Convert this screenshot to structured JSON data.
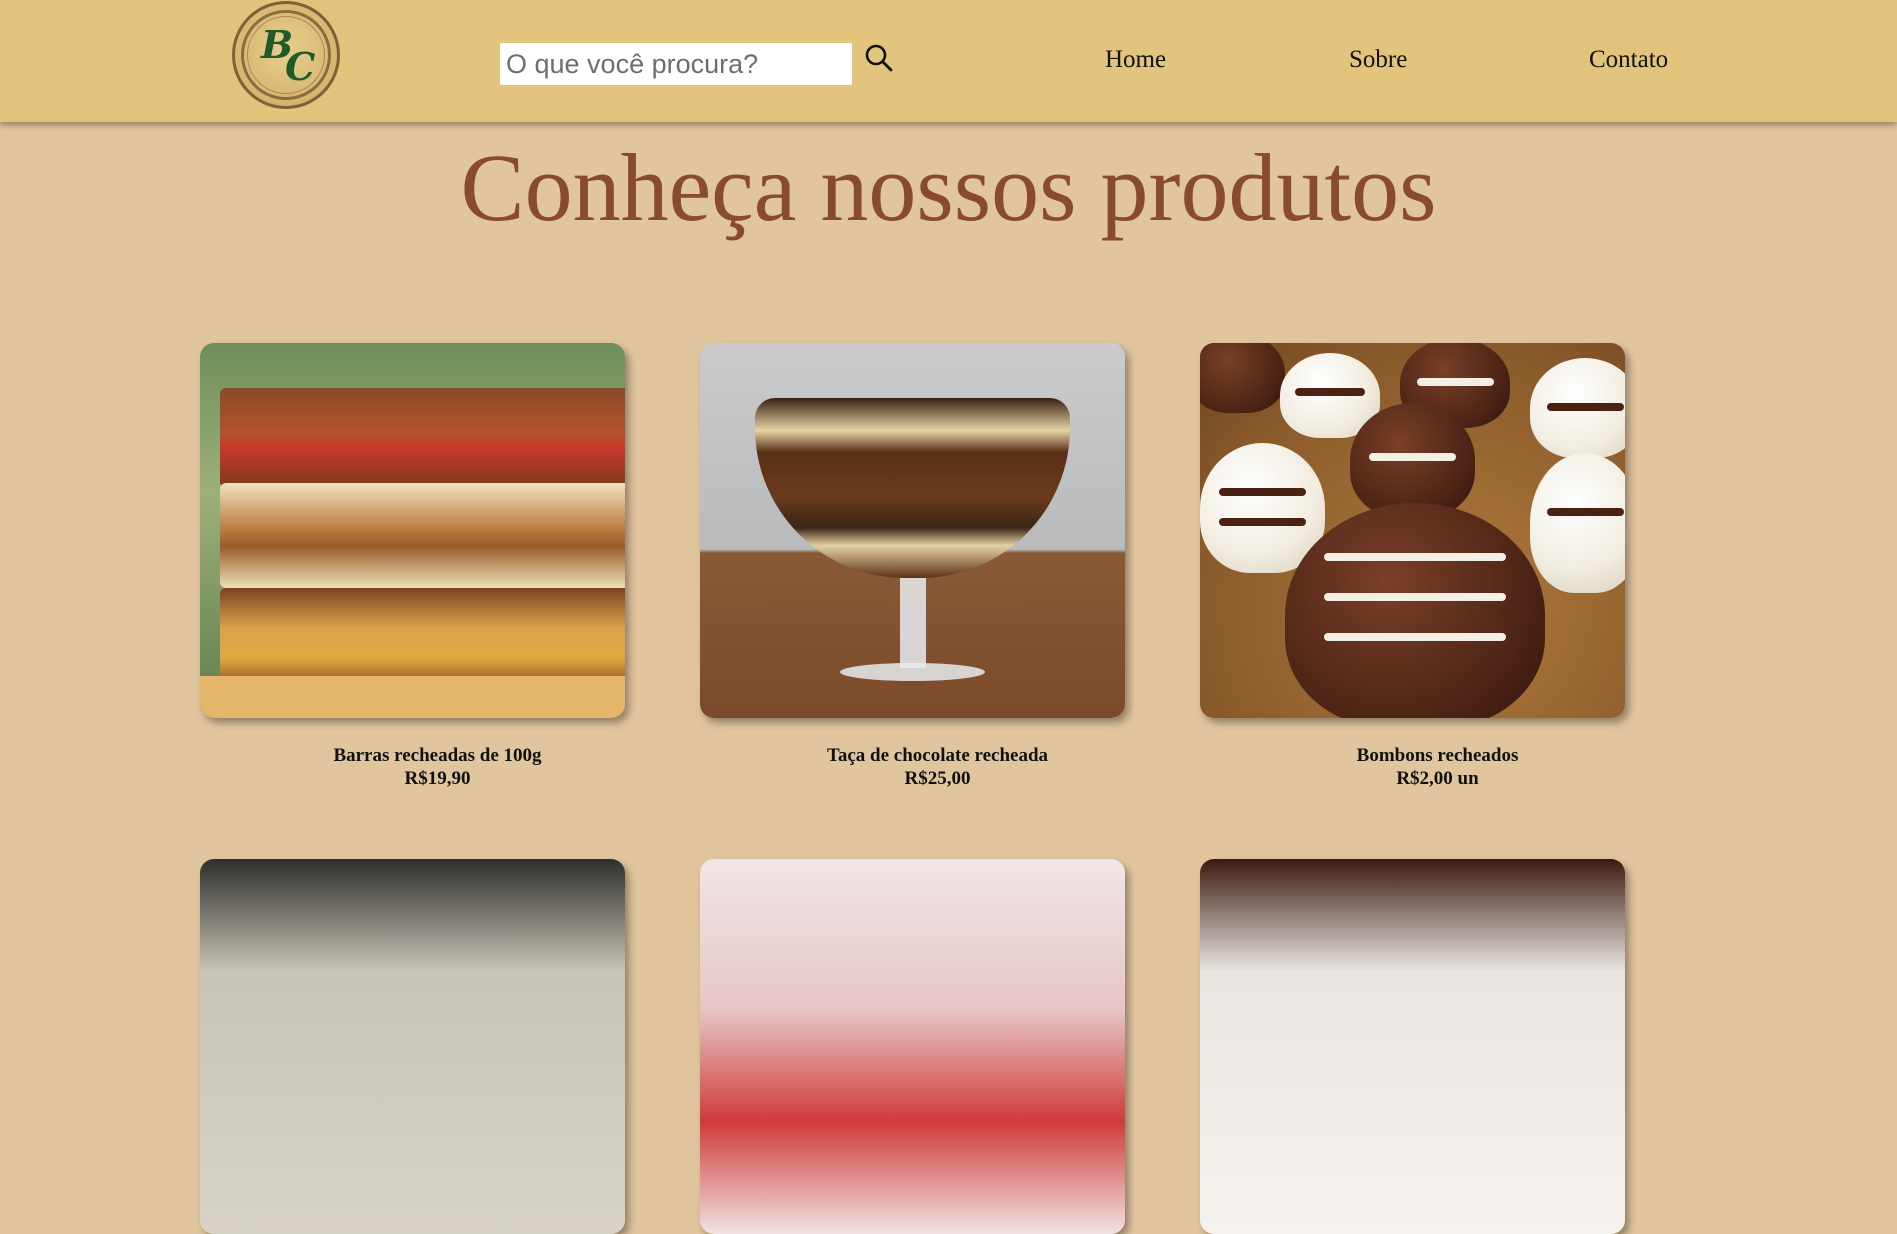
{
  "header": {
    "logo": {
      "text_b": "B",
      "text_c": "C"
    },
    "search": {
      "placeholder": "O que você procura?",
      "value": ""
    },
    "nav": [
      {
        "label": "Home"
      },
      {
        "label": "Sobre"
      },
      {
        "label": "Contato"
      }
    ]
  },
  "main": {
    "title": "Conheça nossos produtos",
    "products": [
      {
        "name": "Barras recheadas de 100g",
        "price": "R$19,90",
        "image": "chocolate-bars-image"
      },
      {
        "name": "Taça de chocolate recheada",
        "price": "R$25,00",
        "image": "chocolate-cup-image"
      },
      {
        "name": "Bombons recheados",
        "price": "R$2,00 un",
        "image": "bonbons-image"
      }
    ],
    "partial_products": [
      {
        "image": "chocolate-box-image"
      },
      {
        "image": "strawberry-dessert-image"
      },
      {
        "image": "cookies-plate-image"
      }
    ]
  },
  "colors": {
    "header_bg": "#e2c47c",
    "page_bg": "#e1c59e",
    "title": "#8a4a2e",
    "logo_letters": "#1f5a2a"
  }
}
